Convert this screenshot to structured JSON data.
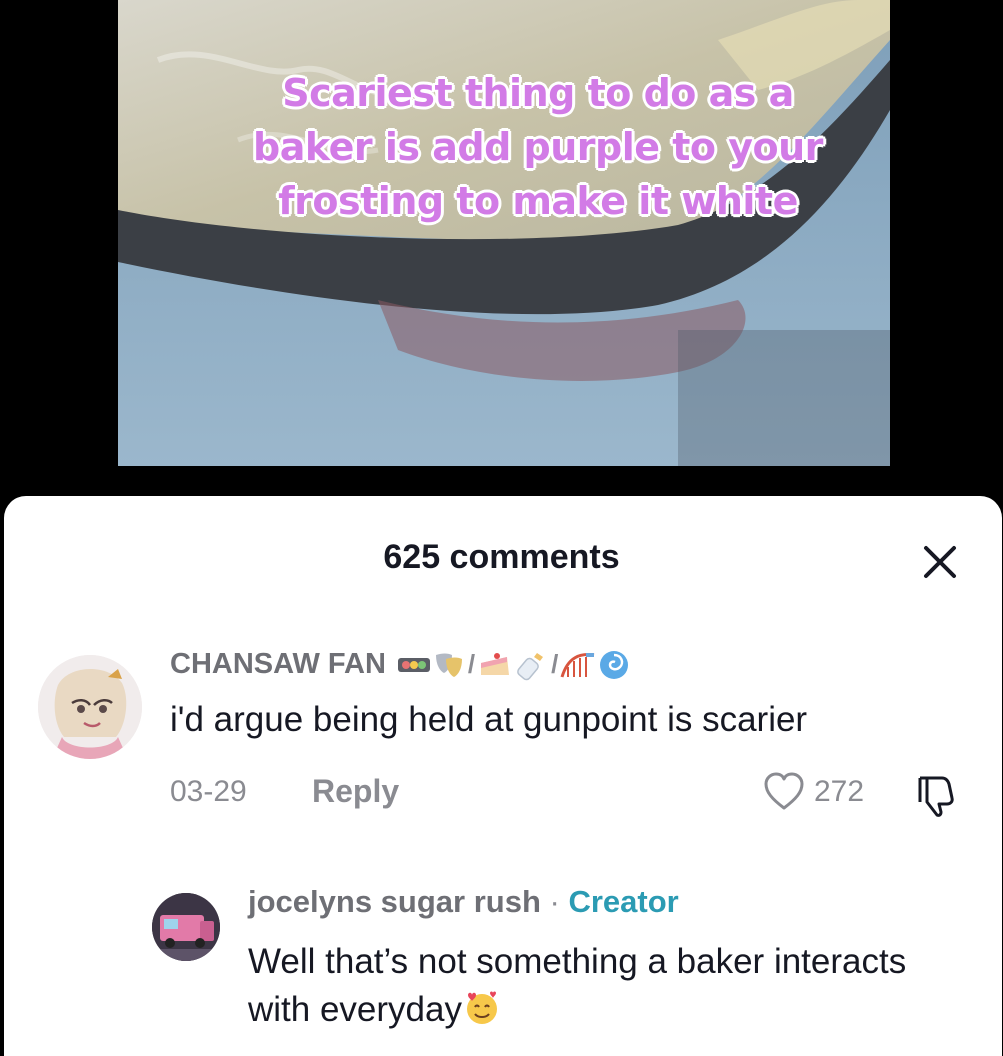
{
  "video": {
    "caption": "Scariest thing to do as a baker is add purple to your frosting to make it white"
  },
  "comments_sheet": {
    "title": "625 comments",
    "close_icon": "close-icon"
  },
  "comment": {
    "username": "CHANSAW FAN",
    "badge_separators": [
      "/",
      "/"
    ],
    "text": "i'd argue being held at gunpoint is scarier",
    "date": "03-29",
    "reply_label": "Reply",
    "like_count": "272",
    "like_icon": "heart-outline-icon",
    "dislike_icon": "thumbs-down-icon"
  },
  "reply": {
    "username": "jocelyns sugar rush",
    "separator": "·",
    "creator_label": "Creator",
    "text": "Well that’s not something a baker interacts with everyday"
  },
  "colors": {
    "caption_fill": "#d27be6",
    "creator": "#2b9bb3",
    "muted_text": "#8a8b91",
    "primary_text": "#161823"
  }
}
